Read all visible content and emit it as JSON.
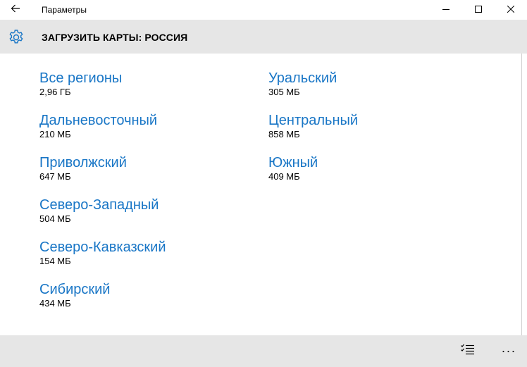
{
  "window": {
    "title": "Параметры",
    "back_icon": "arrow-left-icon",
    "minimize_icon": "minimize-icon",
    "maximize_icon": "maximize-icon",
    "close_icon": "close-icon"
  },
  "header": {
    "icon": "gear-icon",
    "title": "ЗАГРУЗИТЬ КАРТЫ: РОССИЯ"
  },
  "regions_left": [
    {
      "name": "Все регионы",
      "size": "2,96 ГБ"
    },
    {
      "name": "Дальневосточный",
      "size": "210 МБ"
    },
    {
      "name": "Приволжский",
      "size": "647 МБ"
    },
    {
      "name": "Северо-Западный",
      "size": "504 МБ"
    },
    {
      "name": "Северо-Кавказский",
      "size": "154 МБ"
    },
    {
      "name": "Сибирский",
      "size": "434 МБ"
    }
  ],
  "regions_right": [
    {
      "name": "Уральский",
      "size": "305 МБ"
    },
    {
      "name": "Центральный",
      "size": "858 МБ"
    },
    {
      "name": "Южный",
      "size": "409 МБ"
    }
  ],
  "appbar": {
    "select_icon": "multi-select-icon",
    "more_label": "···"
  },
  "colors": {
    "accent": "#1976c6",
    "header_bg": "#e6e6e6"
  }
}
